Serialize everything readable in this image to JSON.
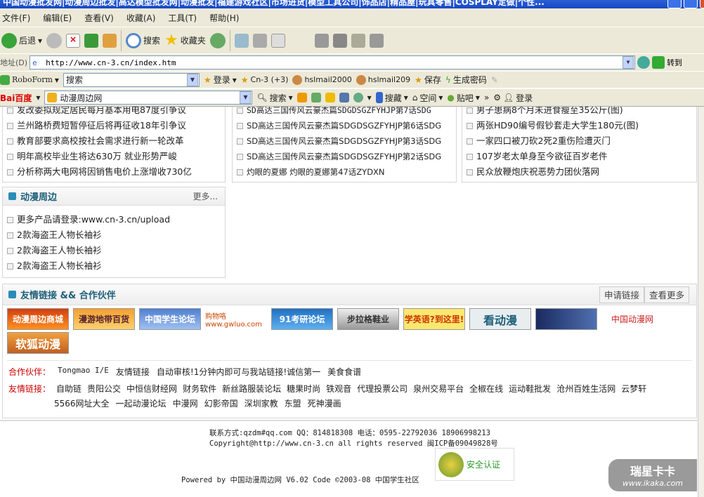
{
  "window": {
    "title": "中国动漫批发网|动漫周边批发|高达模型批发网|动漫批发|福建游戏社区|市场进货|模型工具公司|饰品店|精品屋|玩具零售|COSPLAY定做|个性..."
  },
  "menu": [
    "文件(F)",
    "编辑(E)",
    "查看(V)",
    "收藏(A)",
    "工具(T)",
    "帮助(H)"
  ],
  "toolbar": {
    "back": "后退",
    "search": "搜索",
    "favorites": "收藏夹"
  },
  "address": {
    "label": "地址(D)",
    "url": "http://www.cn-3.cn/index.htm",
    "go": "转到"
  },
  "roboform": {
    "name": "RoboForm",
    "search": "搜索",
    "login": "登录",
    "cn3": "Cn-3 (+3)",
    "mail1": "hslmail2000",
    "mail2": "hslmail209",
    "save": "保存",
    "gen": "生成密码"
  },
  "baidu": {
    "logo": "Bai百度",
    "input": "动漫周边网",
    "search": "搜索",
    "collect": "搜藏",
    "space": "空间",
    "tieba": "贴吧",
    "login": "登录"
  },
  "news": {
    "col1": [
      "发改委拟规定居民每月基本用电87度引争议",
      "兰州路桥费短暂停征后将再征收18年引争议",
      "教育部要求高校按社会需求进行新一轮改革",
      "明年高校毕业生将达630万 就业形势严峻",
      "分析称两大电网将因销售电价上涨增收730亿"
    ],
    "col2": [
      "SD高达三国传风云豪杰篇SDGDSGZFYHJP第7话SDG",
      "SD高达三国传风云豪杰篇SDGDSGZFYHJP第6话SDG",
      "SD高达三国传风云豪杰篇SDGDSGZFYHJP第3话SDG",
      "SD高达三国传风云豪杰篇SDGDSGZFYHJP第2话SDG",
      "灼眼的夏娜 灼眼的夏娜第47话ZYDXN"
    ],
    "col3": [
      "男子患病8个月未进食瘦至35公斤(图)",
      "两张HD90编号假钞套走大学生180元(图)",
      "一家四口被刀砍2死2重伤险遭灭门",
      "107岁老太单身至今欲征百岁老件",
      "民众放鞭炮庆祝恶势力团伙落网"
    ]
  },
  "anime": {
    "title": "动漫周边",
    "more": "更多...",
    "items": [
      "更多产品请登录:www.cn-3.cn/upload",
      "2款海盗王人物长袖衫",
      "2款海盗王人物长袖衫",
      "2款海盗王人物长袖衫"
    ]
  },
  "links": {
    "title": "友情链接 && 合作伙伴",
    "apply": "申请链接",
    "viewmore": "查看更多",
    "logos": [
      "动漫周边商城",
      "漫游地带百货",
      "中国学生论坛",
      "购物咯 www.gwluo.com",
      "91考研论坛",
      "步拉格鞋业",
      "学英语?到这里!",
      "看动漫",
      "",
      "中国动漫网",
      "软狐动漫"
    ],
    "partners_label": "合作伙伴：",
    "partners": [
      "Tongmao I/E",
      "友情链接",
      "自动审核!1分钟内即可与我站链接!诚信第一",
      "美食食谱"
    ],
    "friends_label": "友情链接：",
    "friends": [
      "自助链",
      "贵阳公交",
      "中恒信财经网",
      "财务软件",
      "新丝路服装论坛",
      "糖果时尚",
      "铁观音",
      "代理投票公司",
      "泉州交易平台",
      "全椒在线",
      "运动鞋批发",
      "沧州百姓生活网",
      "云梦轩",
      "5566网址大全",
      "一起动漫论坛",
      "中漫网",
      "幻影帝国",
      "深圳家教",
      "东盟",
      "死神漫画"
    ]
  },
  "footer": {
    "contact": "联系方式:qzdm#qq.com QQ：814818308 电话：0595-22792036 18906998213",
    "copyright": "Copyright@http://www.cn-3.cn all rights reserved 闽ICP备09049828号",
    "powered": "Powered by 中国动漫周边网 V6.02 Code ©2003-08 中国学生社区",
    "badge": "安全认证",
    "watermark": "瑞星卡卡",
    "watermark_url": "www.ikaka.com"
  }
}
